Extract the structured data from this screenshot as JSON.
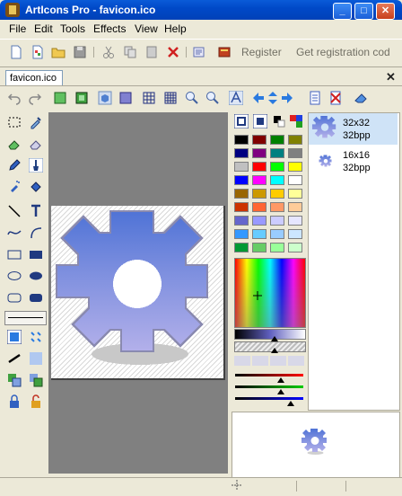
{
  "window": {
    "title": "ArtIcons Pro - favicon.ico",
    "min_glyph": "_",
    "max_glyph": "□",
    "close_glyph": "✕"
  },
  "menu": [
    "File",
    "Edit",
    "Tools",
    "Effects",
    "View",
    "Help"
  ],
  "toolbar": {
    "register_label": "Register",
    "get_registration_label": "Get registration cod"
  },
  "tab": {
    "label": "favicon.ico",
    "close_glyph": "✕"
  },
  "sizes": [
    {
      "size": "32x32",
      "depth": "32bpp"
    },
    {
      "size": "16x16",
      "depth": "32bpp"
    }
  ],
  "palette_colors": [
    "#000000",
    "#800000",
    "#008000",
    "#808000",
    "#000080",
    "#800080",
    "#008080",
    "#808080",
    "#c0c0c0",
    "#ff0000",
    "#00ff00",
    "#ffff00",
    "#0000ff",
    "#ff00ff",
    "#00ffff",
    "#ffffff",
    "#996600",
    "#cc9900",
    "#ffcc00",
    "#ffff99",
    "#cc3300",
    "#ff6633",
    "#ff9966",
    "#ffcc99",
    "#6666cc",
    "#9999ff",
    "#ccccff",
    "#e6e6ff",
    "#3399ff",
    "#66ccff",
    "#99ccff",
    "#cce6ff",
    "#009933",
    "#66cc66",
    "#99ff99",
    "#ccffcc"
  ],
  "colors": {
    "accent": "#0a5bd8",
    "gear_top": "#5f7fd8",
    "gear_bottom": "#a9a6e6"
  }
}
